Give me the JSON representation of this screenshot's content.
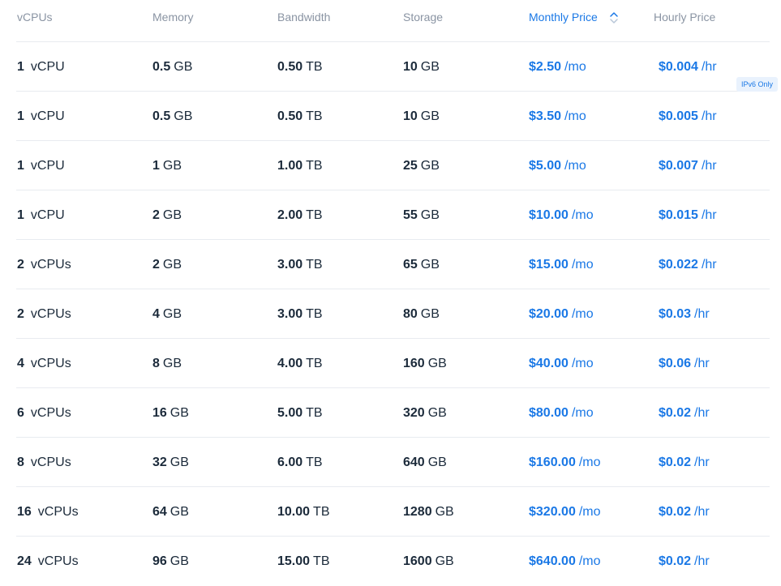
{
  "header": {
    "vcpus": "vCPUs",
    "memory": "Memory",
    "bandwidth": "Bandwidth",
    "storage": "Storage",
    "monthly": "Monthly Price",
    "hourly": "Hourly Price"
  },
  "rows": [
    {
      "vcpu": "1",
      "vcpu_unit": "vCPU",
      "mem": "0.5",
      "mem_unit": "GB",
      "bw": "0.50",
      "bw_unit": "TB",
      "sto": "10",
      "sto_unit": "GB",
      "mo": "$2.50",
      "mo_unit": "/mo",
      "hr": "$0.004",
      "hr_unit": "/hr",
      "badge": "IPv6 Only"
    },
    {
      "vcpu": "1",
      "vcpu_unit": "vCPU",
      "mem": "0.5",
      "mem_unit": "GB",
      "bw": "0.50",
      "bw_unit": "TB",
      "sto": "10",
      "sto_unit": "GB",
      "mo": "$3.50",
      "mo_unit": "/mo",
      "hr": "$0.005",
      "hr_unit": "/hr"
    },
    {
      "vcpu": "1",
      "vcpu_unit": "vCPU",
      "mem": "1",
      "mem_unit": "GB",
      "bw": "1.00",
      "bw_unit": "TB",
      "sto": "25",
      "sto_unit": "GB",
      "mo": "$5.00",
      "mo_unit": "/mo",
      "hr": "$0.007",
      "hr_unit": "/hr"
    },
    {
      "vcpu": "1",
      "vcpu_unit": "vCPU",
      "mem": "2",
      "mem_unit": "GB",
      "bw": "2.00",
      "bw_unit": "TB",
      "sto": "55",
      "sto_unit": "GB",
      "mo": "$10.00",
      "mo_unit": "/mo",
      "hr": "$0.015",
      "hr_unit": "/hr"
    },
    {
      "vcpu": "2",
      "vcpu_unit": "vCPUs",
      "mem": "2",
      "mem_unit": "GB",
      "bw": "3.00",
      "bw_unit": "TB",
      "sto": "65",
      "sto_unit": "GB",
      "mo": "$15.00",
      "mo_unit": "/mo",
      "hr": "$0.022",
      "hr_unit": "/hr"
    },
    {
      "vcpu": "2",
      "vcpu_unit": "vCPUs",
      "mem": "4",
      "mem_unit": "GB",
      "bw": "3.00",
      "bw_unit": "TB",
      "sto": "80",
      "sto_unit": "GB",
      "mo": "$20.00",
      "mo_unit": "/mo",
      "hr": "$0.03",
      "hr_unit": "/hr"
    },
    {
      "vcpu": "4",
      "vcpu_unit": "vCPUs",
      "mem": "8",
      "mem_unit": "GB",
      "bw": "4.00",
      "bw_unit": "TB",
      "sto": "160",
      "sto_unit": "GB",
      "mo": "$40.00",
      "mo_unit": "/mo",
      "hr": "$0.06",
      "hr_unit": "/hr"
    },
    {
      "vcpu": "6",
      "vcpu_unit": "vCPUs",
      "mem": "16",
      "mem_unit": "GB",
      "bw": "5.00",
      "bw_unit": "TB",
      "sto": "320",
      "sto_unit": "GB",
      "mo": "$80.00",
      "mo_unit": "/mo",
      "hr": "$0.02",
      "hr_unit": "/hr"
    },
    {
      "vcpu": "8",
      "vcpu_unit": "vCPUs",
      "mem": "32",
      "mem_unit": "GB",
      "bw": "6.00",
      "bw_unit": "TB",
      "sto": "640",
      "sto_unit": "GB",
      "mo": "$160.00",
      "mo_unit": "/mo",
      "hr": "$0.02",
      "hr_unit": "/hr"
    },
    {
      "vcpu": "16",
      "vcpu_unit": "vCPUs",
      "mem": "64",
      "mem_unit": "GB",
      "bw": "10.00",
      "bw_unit": "TB",
      "sto": "1280",
      "sto_unit": "GB",
      "mo": "$320.00",
      "mo_unit": "/mo",
      "hr": "$0.02",
      "hr_unit": "/hr"
    },
    {
      "vcpu": "24",
      "vcpu_unit": "vCPUs",
      "mem": "96",
      "mem_unit": "GB",
      "bw": "15.00",
      "bw_unit": "TB",
      "sto": "1600",
      "sto_unit": "GB",
      "mo": "$640.00",
      "mo_unit": "/mo",
      "hr": "$0.02",
      "hr_unit": "/hr"
    }
  ],
  "sort": {
    "icon": "sort-chevron-icon",
    "active_column": "Monthly Price"
  },
  "colors": {
    "accent": "#1a78e6",
    "header_text": "#8a94a3",
    "body_text": "#1b2a3a",
    "divider": "#e8ebf0",
    "badge_bg": "#e9f2fd"
  }
}
